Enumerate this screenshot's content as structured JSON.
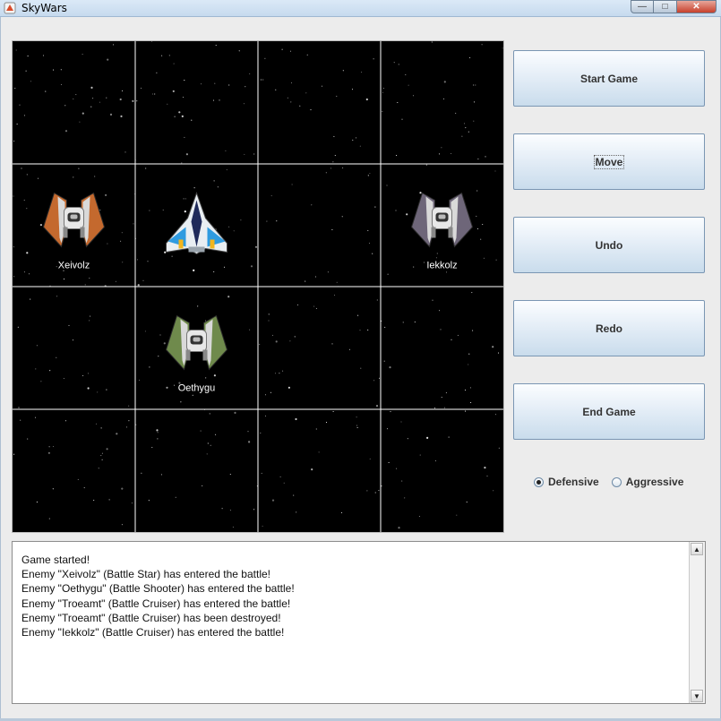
{
  "window": {
    "title": "SkyWars"
  },
  "controls": {
    "start": "Start Game",
    "move": "Move",
    "undo": "Undo",
    "redo": "Redo",
    "end": "End Game"
  },
  "mode": {
    "defensive": "Defensive",
    "aggressive": "Aggressive",
    "selected": "Defensive"
  },
  "grid": {
    "rows": 4,
    "cols": 4,
    "ships": [
      {
        "row": 1,
        "col": 0,
        "type": "enemy",
        "color": "#c4692e",
        "label": "Xeivolz"
      },
      {
        "row": 1,
        "col": 1,
        "type": "player",
        "color": "#2f9be0",
        "label": ""
      },
      {
        "row": 1,
        "col": 3,
        "type": "enemy",
        "color": "#6e6679",
        "label": "Iekkolz"
      },
      {
        "row": 2,
        "col": 1,
        "type": "enemy",
        "color": "#6f8a4c",
        "label": "Oethygu"
      }
    ]
  },
  "log": {
    "lines": [
      "Game started!",
      "Enemy \"Xeivolz\" (Battle Star) has entered the battle!",
      "Enemy \"Oethygu\" (Battle Shooter) has entered the battle!",
      "Enemy \"Troeamt\" (Battle Cruiser) has entered the battle!",
      "Enemy \"Troeamt\" (Battle Cruiser) has been destroyed!",
      "Enemy \"Iekkolz\" (Battle Cruiser) has entered the battle!"
    ]
  }
}
